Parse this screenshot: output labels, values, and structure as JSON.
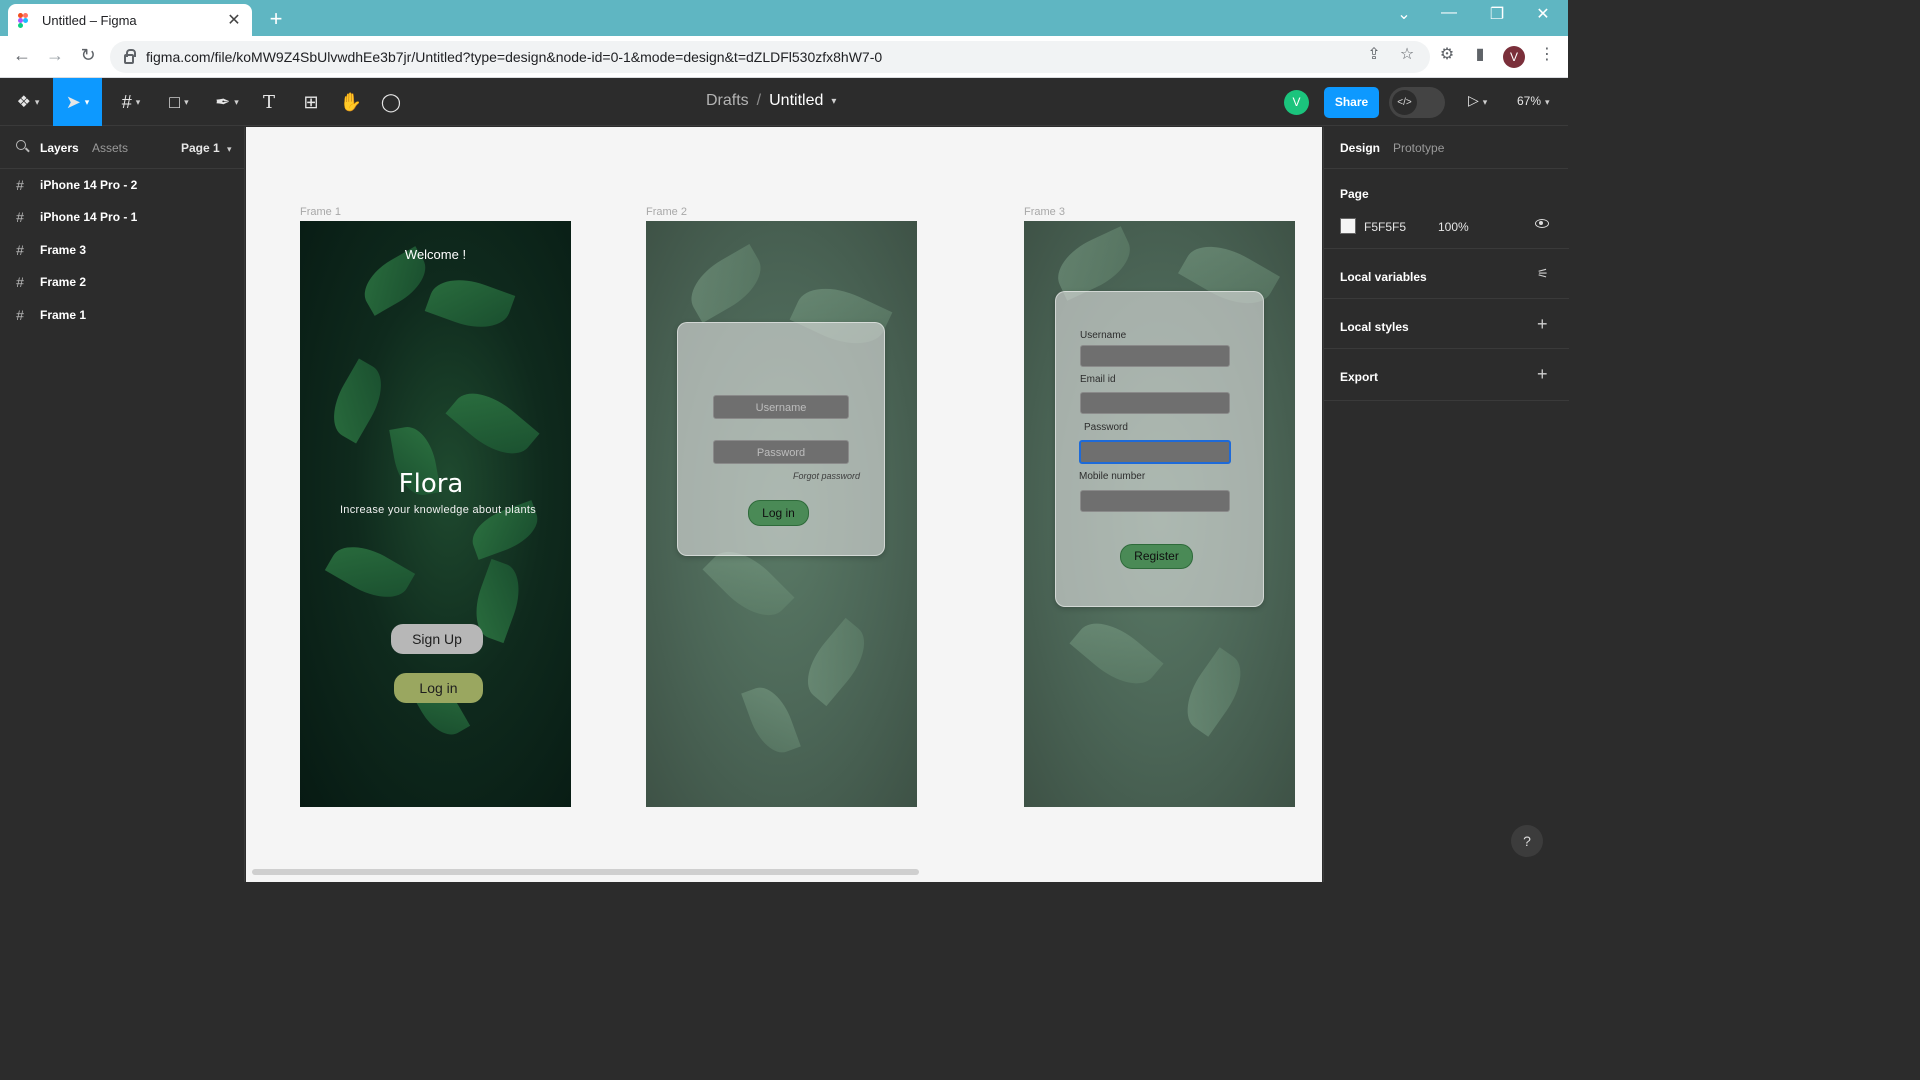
{
  "browser": {
    "tab_title": "Untitled – Figma",
    "tab_close": "✕",
    "new_tab": "+",
    "url": "figma.com/file/koMW9Z4SbUlvwdhEe3b7jr/Untitled?type=design&node-id=0-1&mode=design&t=dZLDFl530zfx8hW7-0",
    "profile_initial": "V",
    "window_controls": [
      "⌄",
      "—",
      "❐",
      "✕"
    ]
  },
  "toolbar": {
    "breadcrumb_team": "Drafts",
    "breadcrumb_sep": "/",
    "file_name": "Untitled",
    "user_initial": "V",
    "share_label": "Share",
    "zoom": "67%",
    "devmode_glyph": "</>"
  },
  "left_panel": {
    "tabs": [
      "Layers",
      "Assets"
    ],
    "page_selector": "Page 1",
    "layers": [
      {
        "name": "iPhone 14 Pro - 2"
      },
      {
        "name": "iPhone 14 Pro - 1"
      },
      {
        "name": "Frame 3"
      },
      {
        "name": "Frame 2"
      },
      {
        "name": "Frame 1"
      }
    ]
  },
  "canvas": {
    "frames": [
      {
        "label": "Frame 1",
        "welcome": "Welcome !",
        "title": "Flora",
        "tagline": "Increase your knowledge about plants",
        "signup_label": "Sign Up",
        "login_label": "Log in"
      },
      {
        "label": "Frame 2",
        "username_placeholder": "Username",
        "password_placeholder": "Password",
        "forgot_label": "Forgot password",
        "login_label": "Log in"
      },
      {
        "label": "Frame 3",
        "username_label": "Username",
        "email_label": "Email id",
        "password_label": "Password",
        "mobile_label": "Mobile number",
        "register_label": "Register"
      }
    ]
  },
  "right_panel": {
    "tabs": [
      "Design",
      "Prototype"
    ],
    "page_section_title": "Page",
    "page_color": "F5F5F5",
    "page_opacity": "100%",
    "local_variables": "Local variables",
    "local_styles": "Local styles",
    "export": "Export",
    "help": "?"
  },
  "colors": {
    "accent": "#0d99ff",
    "canvas_bg": "#f5f5f5",
    "tab_strip": "#5fb6c2"
  }
}
